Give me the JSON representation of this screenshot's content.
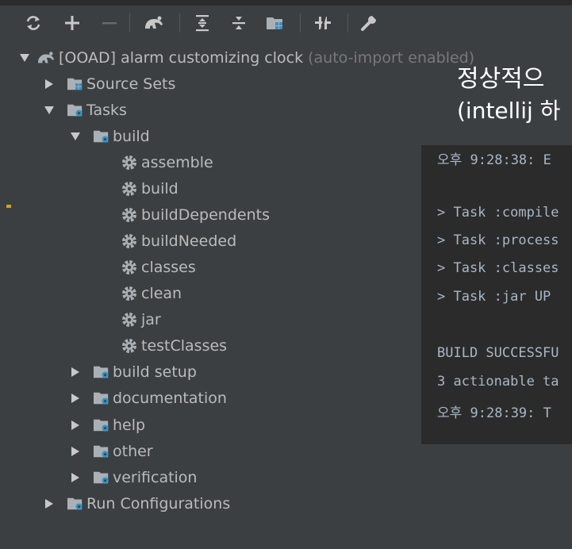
{
  "toolbar": {
    "buttons": [
      {
        "name": "refresh-icon"
      },
      {
        "name": "add-icon"
      },
      {
        "name": "remove-icon"
      },
      {
        "name": "gradle-elephant-icon"
      },
      {
        "name": "expand-all-icon"
      },
      {
        "name": "collapse-all-icon"
      },
      {
        "name": "group-modules-icon"
      },
      {
        "name": "toggle-offline-icon"
      },
      {
        "name": "settings-wrench-icon"
      }
    ]
  },
  "tree": {
    "root": {
      "label": "[OOAD] alarm customizing clock",
      "hint": "(auto-import enabled)"
    },
    "source_sets": "Source Sets",
    "tasks": "Tasks",
    "build": "build",
    "build_tasks": [
      "assemble",
      "build",
      "buildDependents",
      "buildNeeded",
      "classes",
      "clean",
      "jar",
      "testClasses"
    ],
    "groups": [
      "build setup",
      "documentation",
      "help",
      "other",
      "verification"
    ],
    "run_configurations": "Run Configurations"
  },
  "console": {
    "lines": [
      "오후 9:28:38: E",
      "",
      "> Task :compile",
      "> Task :process",
      "> Task :classes",
      "> Task :jar UP",
      "",
      "BUILD SUCCESSFU",
      "3 actionable ta",
      "오후 9:28:39: T"
    ]
  },
  "overlay": {
    "line1": "정상적으",
    "line2": "(intellij 하"
  }
}
